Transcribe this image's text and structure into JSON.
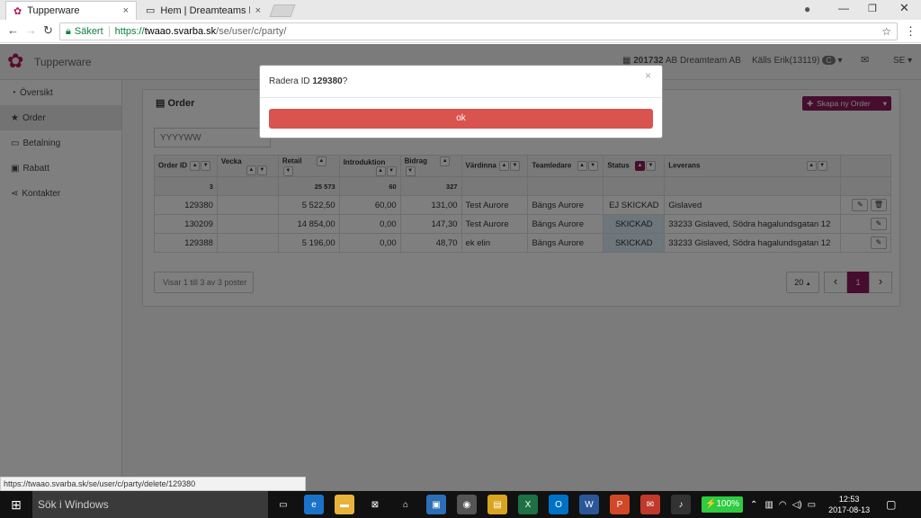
{
  "browser": {
    "tabs": [
      {
        "title": "Tupperware",
        "close": "×"
      },
      {
        "title": "Hem | Dreamteams hem",
        "close": "×"
      }
    ],
    "secure_label": "Säkert",
    "url_scheme": "https://",
    "url_host": "twaao.svarba.sk",
    "url_path": "/se/user/c/party/",
    "status_url": "https://twaao.svarba.sk/se/user/c/party/delete/129380"
  },
  "header": {
    "brand": "Tupperware",
    "company_id": "201732",
    "company_name": "AB Dreamteam AB",
    "user": "Källs Erik(13119)",
    "user_badge": "C",
    "language": "SE"
  },
  "sidebar": {
    "items": [
      {
        "label": "Översikt"
      },
      {
        "label": "Order"
      },
      {
        "label": "Betalning"
      },
      {
        "label": "Rabatt"
      },
      {
        "label": "Kontakter"
      }
    ]
  },
  "panel": {
    "title": "Order",
    "create_button": "Skapa ny Order",
    "week_placeholder": "YYYYWW"
  },
  "table": {
    "headers": [
      "Order ID",
      "Vecka",
      "Retail",
      "Introduktion",
      "Bidrag",
      "Värdinna",
      "Teamledare",
      "Status",
      "Leverans"
    ],
    "totals": [
      "3",
      "",
      "25 573",
      "60",
      "327",
      "",
      "",
      "",
      ""
    ],
    "rows": [
      {
        "id": "129380",
        "vecka": "",
        "retail": "5 522,50",
        "intro": "60,00",
        "bidrag": "131,00",
        "vardinna": "Test Aurore",
        "teamledare": "Bängs Aurore",
        "status": "EJ SKICKAD",
        "leverans": "Gislaved"
      },
      {
        "id": "130209",
        "vecka": "",
        "retail": "14 854,00",
        "intro": "0,00",
        "bidrag": "147,30",
        "vardinna": "Test Aurore",
        "teamledare": "Bängs Aurore",
        "status": "SKICKAD",
        "leverans": "33233 Gislaved, Södra hagalundsgatan 12"
      },
      {
        "id": "129388",
        "vecka": "",
        "retail": "5 196,00",
        "intro": "0,00",
        "bidrag": "48,70",
        "vardinna": "ek elin",
        "teamledare": "Bängs Aurore",
        "status": "SKICKAD",
        "leverans": "33233 Gislaved, Södra hagalundsgatan 12"
      }
    ]
  },
  "pagination": {
    "info": "Visar 1 till 3 av 3 poster",
    "page_size": "20",
    "prev": "‹",
    "current": "1",
    "next": "›"
  },
  "modal": {
    "question_prefix": "Radera ID ",
    "question_id": "129380",
    "question_suffix": "?",
    "ok_label": "ok",
    "close": "×"
  },
  "taskbar": {
    "search": "Sök i Windows",
    "battery": "100%",
    "time": "12:53",
    "date": "2017-08-13"
  },
  "colors": {
    "accent": "#8c1a5c",
    "danger": "#d9534f",
    "sent": "#d9edf7"
  }
}
